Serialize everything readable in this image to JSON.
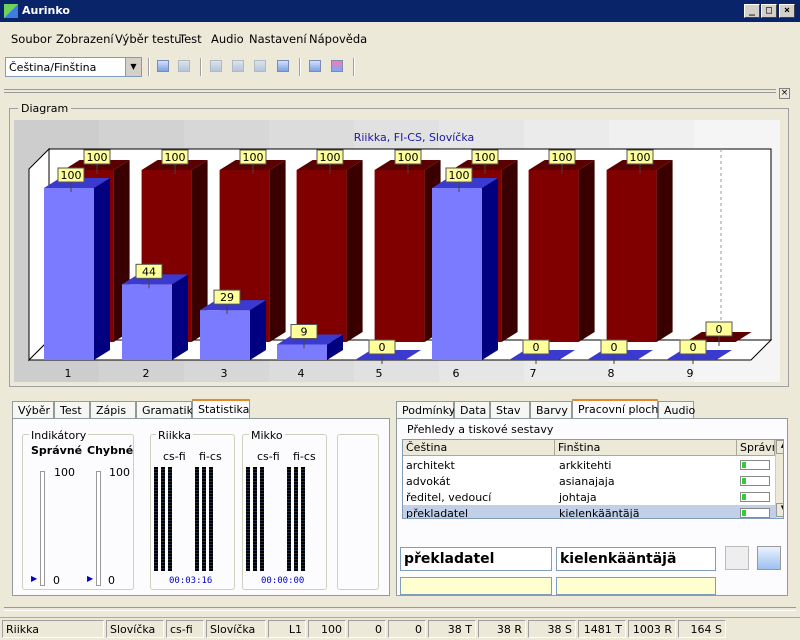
{
  "window": {
    "title": "Aurinko"
  },
  "menu": [
    "Soubor",
    "Zobrazení",
    "Výběr testu",
    "Test",
    "Audio",
    "Nastavení",
    "Nápověda"
  ],
  "toolbar": {
    "combo_value": "Čeština/Finština"
  },
  "diagram": {
    "group_label": "Diagram"
  },
  "chart_data": {
    "type": "bar",
    "title": "Riikka, FI-CS, Slovíčka",
    "categories": [
      "1",
      "2",
      "3",
      "4",
      "5",
      "6",
      "7",
      "8",
      "9"
    ],
    "series": [
      {
        "values": [
          100,
          44,
          29,
          9,
          0,
          100,
          0,
          0,
          0
        ],
        "color": "#7b7bff"
      },
      {
        "values": [
          100,
          100,
          100,
          100,
          100,
          100,
          100,
          100,
          0
        ],
        "color": "#800000"
      }
    ],
    "ylim": [
      0,
      100
    ],
    "grid": false
  },
  "left_tabs": [
    "Výběr",
    "Test",
    "Zápis",
    "Gramatika",
    "Statistika"
  ],
  "left_tabs_selected": 4,
  "stats": {
    "indikatory": {
      "label": "Indikátory",
      "col1": "Správné",
      "col2": "Chybné",
      "max": "100",
      "min1": "0",
      "min2": "0"
    },
    "riikka": {
      "label": "Riikka",
      "col1": "cs-fi",
      "col2": "fi-cs",
      "time": "00:03:16"
    },
    "mikko": {
      "label": "Mikko",
      "col1": "cs-fi",
      "col2": "fi-cs",
      "time": "00:00:00"
    }
  },
  "right_tabs": [
    "Podmínky",
    "Data",
    "Stav",
    "Barvy",
    "Pracovní plocha",
    "Audio"
  ],
  "right_tabs_selected": 4,
  "prehledy": {
    "label": "Přehledy a tiskové sestavy",
    "headers": [
      "Čeština",
      "Finština",
      "Správně"
    ],
    "rows": [
      {
        "cs": "architekt",
        "fi": "arkkitehti"
      },
      {
        "cs": "advokát",
        "fi": "asianajaja"
      },
      {
        "cs": "ředitel, vedoucí",
        "fi": "johtaja"
      },
      {
        "cs": "překladatel",
        "fi": "kielenkääntäjä"
      }
    ],
    "selected_row": 3
  },
  "current": {
    "cs": "překladatel",
    "fi": "kielenkääntäjä"
  },
  "status": [
    "Riikka",
    "Slovíčka",
    "cs-fi",
    "Slovíčka",
    "L1",
    "100",
    "0",
    "0",
    "38 T",
    "38 R",
    "38 S",
    "1481 T",
    "1003 R",
    "164 S"
  ],
  "colors": {
    "titlebar": "#0a246a",
    "bar_blue": "#7b7bff",
    "bar_red": "#800000",
    "label_yellow": "#ffff99"
  }
}
